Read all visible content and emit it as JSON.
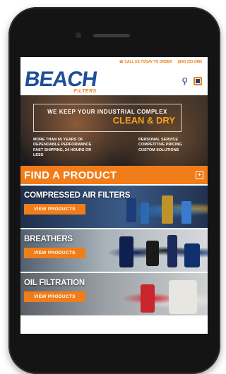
{
  "topbar": {
    "call_label": "CALL US TODAY TO ORDER",
    "phone_number": "(800) 233-2486"
  },
  "header": {
    "logo_brand": "BEACH",
    "logo_sub": "FILTERS"
  },
  "hero": {
    "line1": "WE KEEP YOUR INDUSTRIAL COMPLEX",
    "line2": "CLEAN & DRY",
    "left_list": [
      "MORE THAN 65 YEARS OF",
      "DEPENDABLE PERFORMANCE",
      "FAST SHIPPING, 24 HOURS OR",
      "LESS"
    ],
    "right_list": [
      "PERSONAL SERVICE",
      "COMPETITIVE PRICING",
      "CUSTOM SOLUTIONS"
    ]
  },
  "find": {
    "title": "FIND A PRODUCT",
    "toggle": "+"
  },
  "products": [
    {
      "name": "COMPRESSED AIR FILTERS",
      "button": "VIEW PRODUCTS"
    },
    {
      "name": "BREATHERS",
      "button": "VIEW PRODUCTS"
    },
    {
      "name": "OIL FILTRATION",
      "button": "VIEW PRODUCTS"
    }
  ],
  "colors": {
    "accent": "#f07d1a",
    "brand_blue": "#1f4e9a"
  }
}
